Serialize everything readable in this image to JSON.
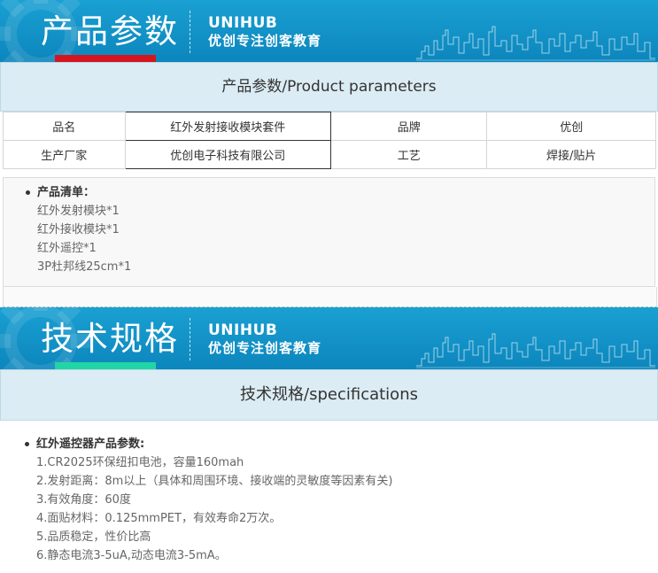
{
  "banner1": {
    "title": "产品参数",
    "brand": "UNIHUB",
    "slogan": "优创专注创客教育",
    "underline_color": "#d4151e"
  },
  "section1": {
    "heading": "产品参数/Product parameters"
  },
  "params_table": {
    "rows": [
      [
        "品名",
        "红外发射接收模块套件",
        "品牌",
        "优创"
      ],
      [
        "生产厂家",
        "优创电子科技有限公司",
        "工艺",
        "焊接/贴片"
      ]
    ]
  },
  "product_list": {
    "heading": "产品清单：",
    "lines": [
      "红外发射模块*1",
      "红外接收模块*1",
      "红外遥控*1",
      "3P杜邦线25cm*1"
    ]
  },
  "banner2": {
    "title": "技术规格",
    "brand": "UNIHUB",
    "slogan": "优创专注创客教育",
    "underline_color": "#21d6a6"
  },
  "section2": {
    "heading": "技术规格/specifications"
  },
  "spec_list": {
    "heading": "红外遥控器产品参数:",
    "lines": [
      "1.CR2025环保纽扣电池，容量160mah",
      "2.发射距离：8m以上（具体和周围环境、接收端的灵敏度等因素有关)",
      "3.有效角度：60度",
      "4.面贴材料：0.125mmPET，有效寿命2万次。",
      "5.品质稳定，性价比高",
      "6.静态电流3-5uA,动态电流3-5mA。"
    ]
  },
  "colors": {
    "banner_bg": "#0f8fc6",
    "section_head_bg": "#dcecf4"
  },
  "icons": [
    "gear-icon",
    "city-skyline-icon"
  ]
}
